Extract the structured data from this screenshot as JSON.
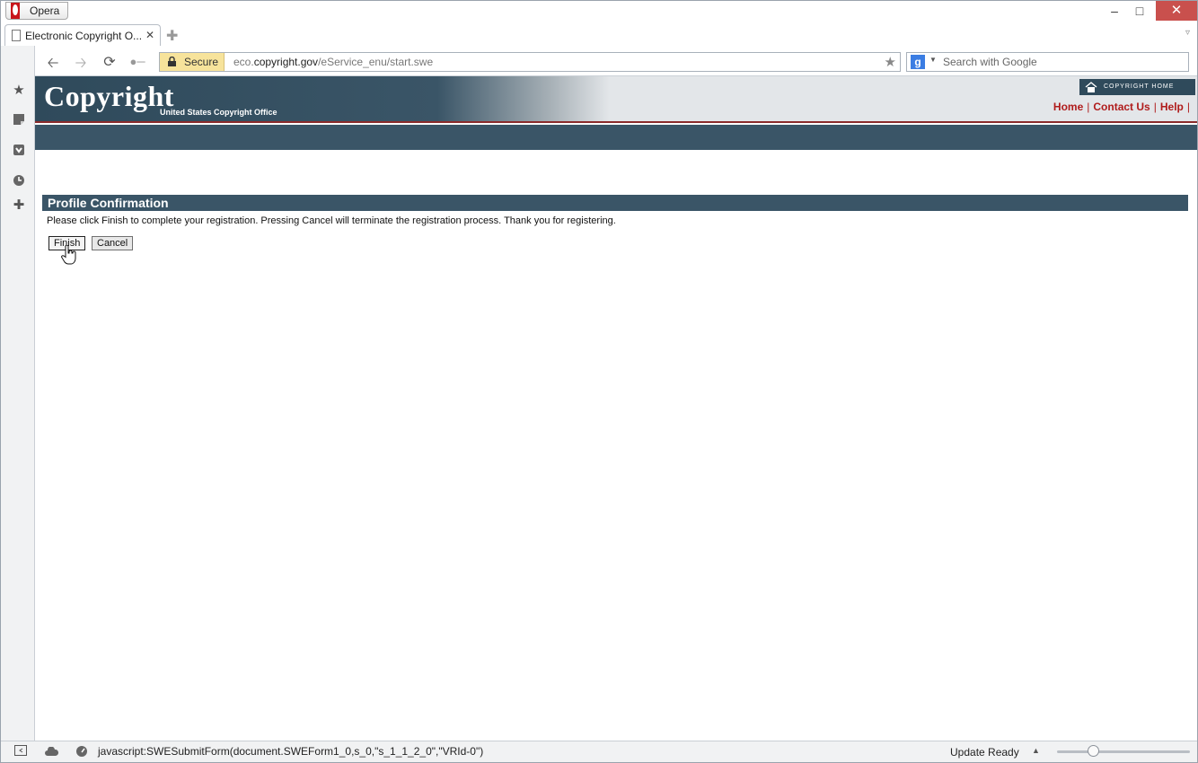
{
  "browser": {
    "menu_label": "Opera",
    "window_controls": {
      "minimize": "–",
      "maximize": "□",
      "close": "✕"
    },
    "tab": {
      "title": "Electronic Copyright O...",
      "close": "✕"
    },
    "new_tab": "✚",
    "address": {
      "secure_label": "Secure",
      "url_domain_prefix": "eco.",
      "url_domain": "copyright.gov",
      "url_path": "/eService_enu/start.swe"
    },
    "search_placeholder": "Search with Google",
    "search_engine_glyph": "g"
  },
  "site": {
    "logo_text": "Copyright",
    "logo_subtitle": "United States Copyright Office",
    "copyright_home_label": "COPYRIGHT HOME",
    "top_links": [
      "Home",
      "Contact Us",
      "Help"
    ],
    "brand_colors": {
      "dark_blue": "#3a5567",
      "link_red": "#b01c1c"
    }
  },
  "form": {
    "section_title": "Profile Confirmation",
    "instructions": "Please click Finish to complete your registration. Pressing Cancel will terminate the registration process. Thank you for registering.",
    "finish_label": "Finish",
    "cancel_label": "Cancel"
  },
  "statusbar": {
    "status_text": "javascript:SWESubmitForm(document.SWEForm1_0,s_0,\"s_1_1_2_0\",\"VRId-0\")",
    "update_label": "Update Ready"
  },
  "icons": {
    "panel": [
      "bookmarks-star-icon",
      "notes-icon",
      "downloads-icon",
      "history-icon",
      "add-panel-icon"
    ],
    "status": [
      "panel-toggle-icon",
      "unite-cloud-icon",
      "turbo-speedometer-icon"
    ]
  }
}
